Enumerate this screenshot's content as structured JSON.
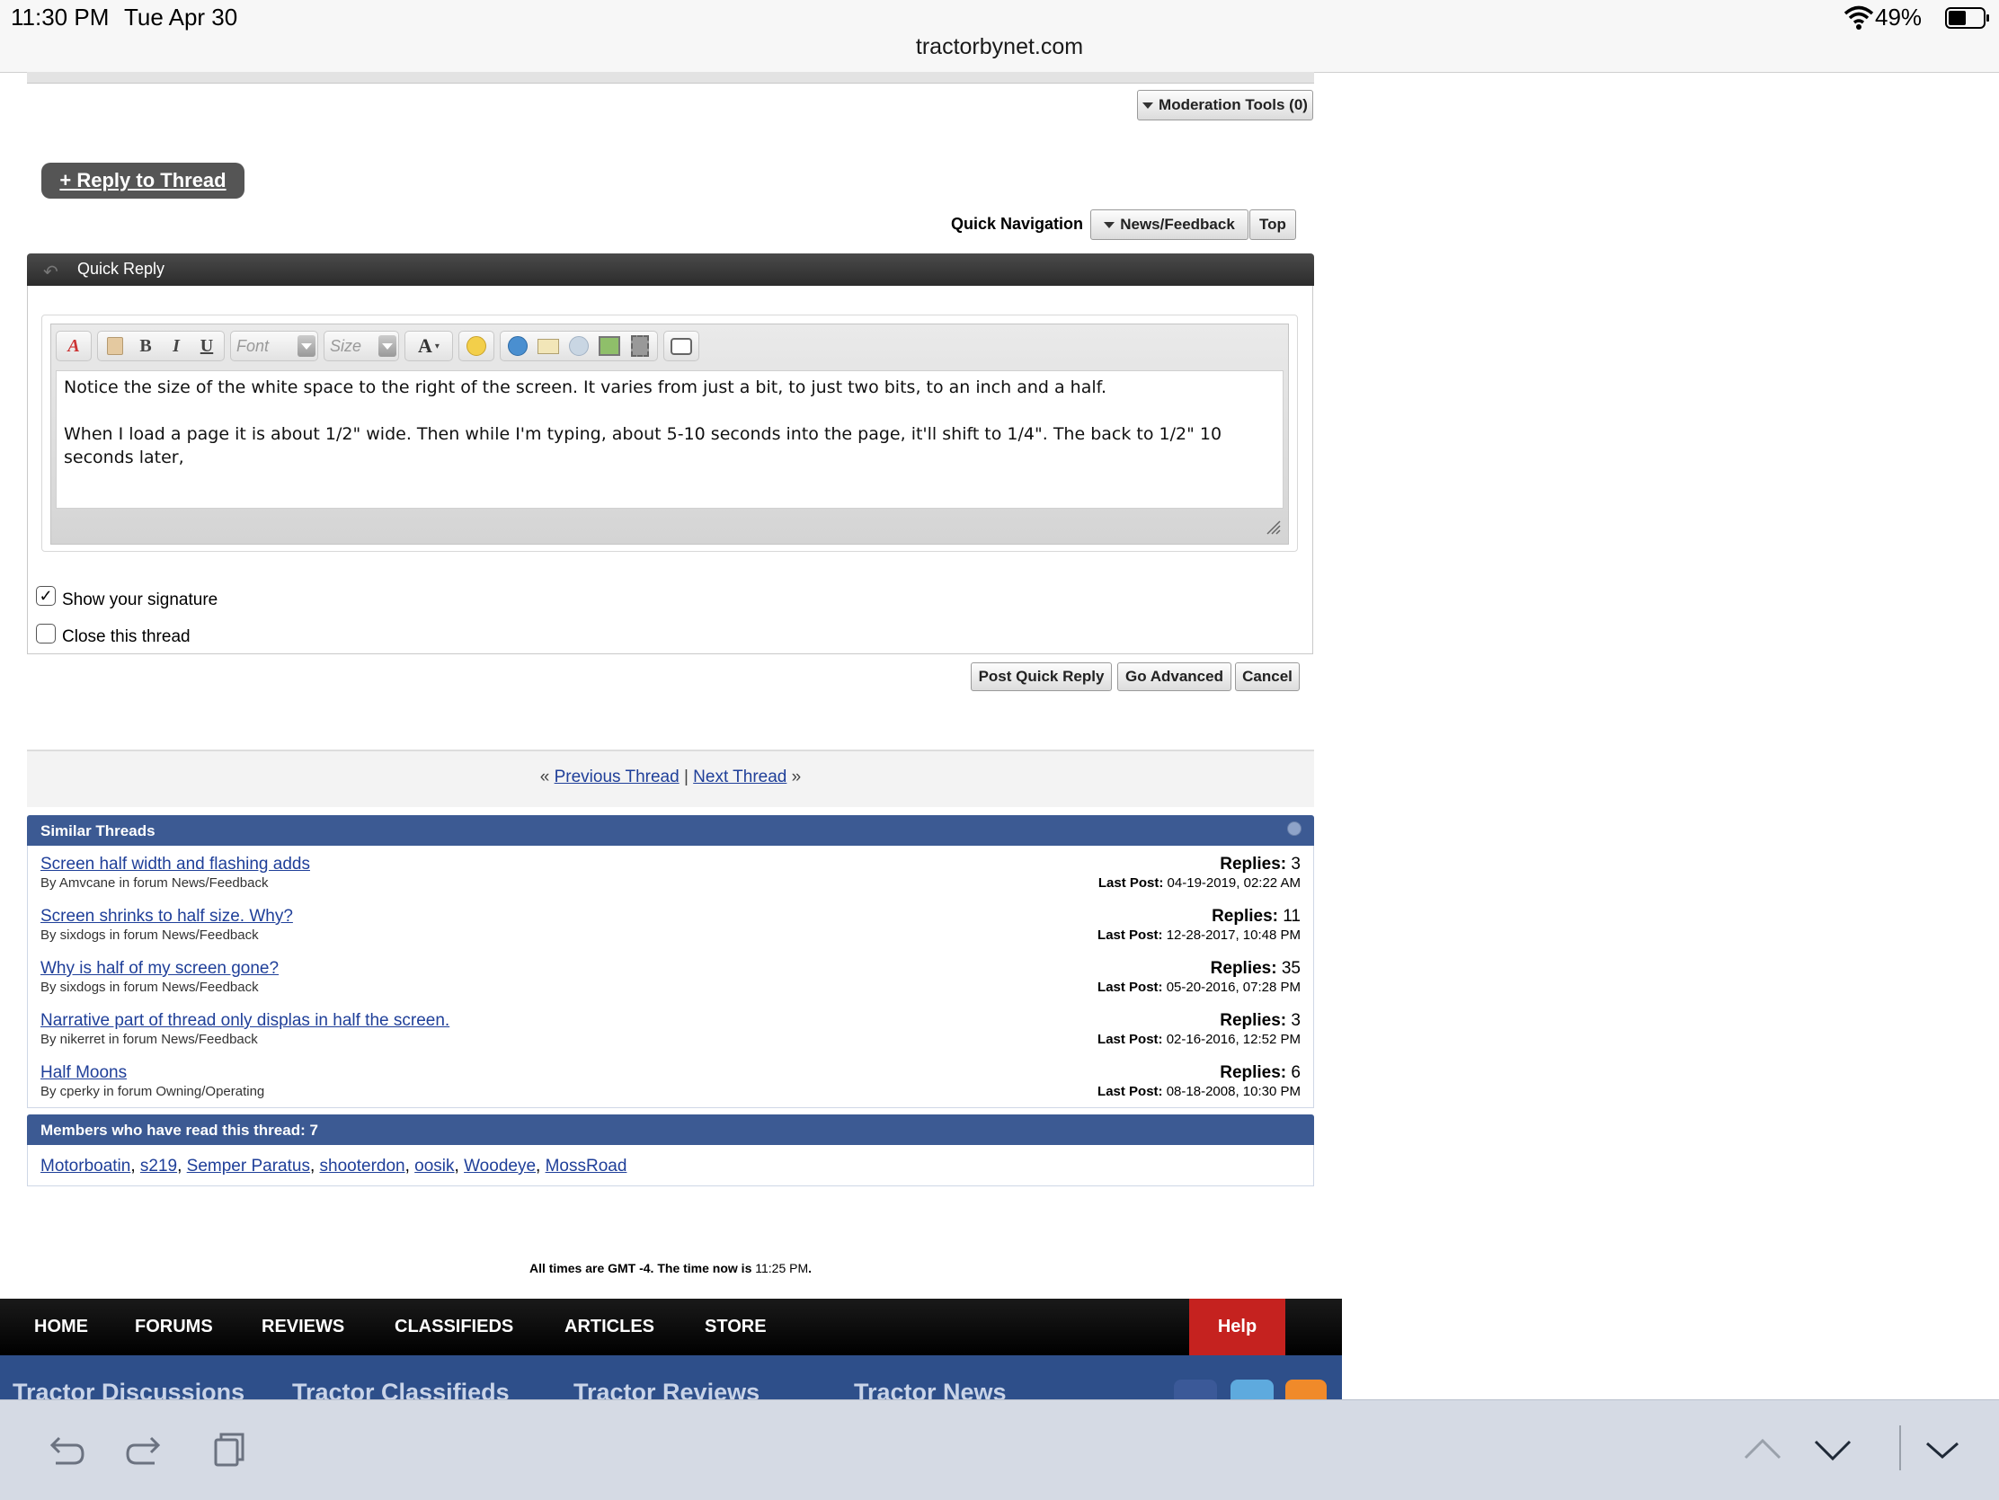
{
  "status": {
    "time": "11:30 PM",
    "date": "Tue Apr 30",
    "battery": "49%",
    "url": "tractorbynet.com"
  },
  "moderation_tools_label": "Moderation Tools (0)",
  "reply_button_label": "+ Reply to Thread",
  "quick_nav": {
    "label": "Quick Navigation",
    "forum_select": "News/Feedback",
    "top_label": "Top"
  },
  "quick_reply": {
    "title": "Quick Reply",
    "font_placeholder": "Font",
    "size_placeholder": "Size",
    "message_line1": "Notice the size of the white space to the right of the screen. It varies from just a bit, to just two bits, to an inch and a half.",
    "message_line2": "When I load a page it is about 1/2\" wide. Then while I'm typing, about 5-10 seconds into the page, it'll shift to 1/4\". The back to 1/2\" 10 seconds later,",
    "show_signature_label": "Show your signature",
    "show_signature_checked": true,
    "close_thread_label": "Close this thread",
    "close_thread_checked": false,
    "post_label": "Post Quick Reply",
    "advanced_label": "Go Advanced",
    "cancel_label": "Cancel"
  },
  "thread_nav": {
    "prev_marker": "«",
    "prev_label": "Previous Thread",
    "separator": "|",
    "next_label": "Next Thread",
    "next_marker": "»"
  },
  "similar_threads": {
    "title": "Similar Threads",
    "replies_label": "Replies:",
    "last_post_label": "Last Post:",
    "items": [
      {
        "title": "Screen half width and flashing adds",
        "by": "By Amvcane in forum News/Feedback",
        "replies": "3",
        "last_post": "04-19-2019, 02:22 AM"
      },
      {
        "title": "Screen shrinks to half size. Why?",
        "by": "By sixdogs in forum News/Feedback",
        "replies": "11",
        "last_post": "12-28-2017, 10:48 PM"
      },
      {
        "title": "Why is half of my screen gone?",
        "by": "By sixdogs in forum News/Feedback",
        "replies": "35",
        "last_post": "05-20-2016, 07:28 PM"
      },
      {
        "title": "Narrative part of thread only displas in half the screen.",
        "by": "By nikerret in forum News/Feedback",
        "replies": "3",
        "last_post": "02-16-2016, 12:52 PM"
      },
      {
        "title": "Half Moons",
        "by": "By cperky in forum Owning/Operating",
        "replies": "6",
        "last_post": "08-18-2008, 10:30 PM"
      }
    ]
  },
  "members": {
    "title": "Members who have read this thread: 7",
    "names": [
      "Motorboatin",
      "s219",
      "Semper Paratus",
      "shooterdon",
      "oosik",
      "Woodeye",
      "MossRoad"
    ]
  },
  "times": {
    "prefix": "All times are GMT -4. The time now is",
    "now": "11:25 PM",
    "suffix": "."
  },
  "footer_nav": {
    "items": [
      "HOME",
      "FORUMS",
      "REVIEWS",
      "CLASSIFIEDS",
      "ARTICLES",
      "STORE"
    ],
    "help": "Help"
  },
  "footer_band": [
    "Tractor Discussions",
    "Tractor Classifieds",
    "Tractor Reviews",
    "Tractor News"
  ],
  "colors": {
    "accent_blue": "#3c5a93",
    "help_red": "#c5221f",
    "link": "#1f3f99"
  }
}
